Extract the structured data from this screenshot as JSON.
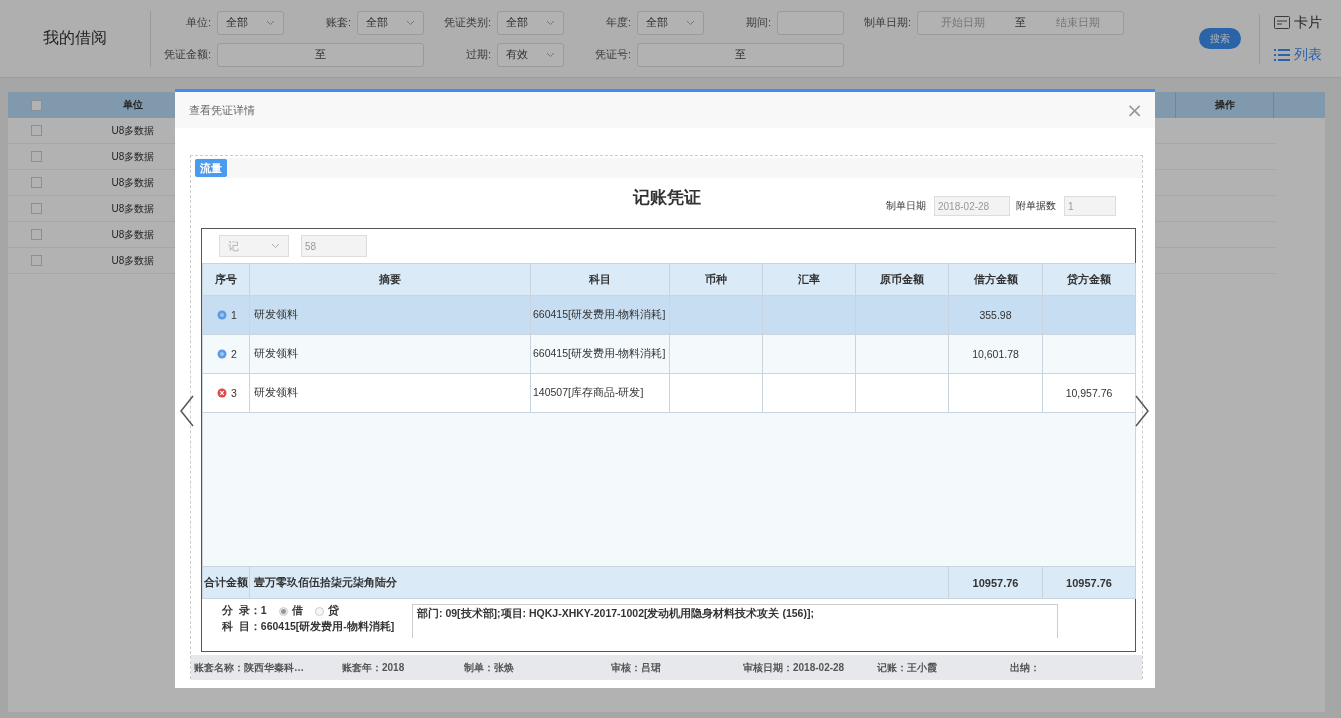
{
  "page": {
    "title": "我的借阅"
  },
  "filters": {
    "rows": [
      [
        {
          "kind": "select",
          "label": "单位:",
          "value": "全部"
        },
        {
          "kind": "select",
          "label": "账套:",
          "value": "全部"
        },
        {
          "kind": "select",
          "label": "凭证类别:",
          "value": "全部"
        },
        {
          "kind": "select",
          "label": "年度:",
          "value": "全部"
        },
        {
          "kind": "input",
          "label": "期间:"
        },
        {
          "kind": "range",
          "label": "制单日期:",
          "from_placeholder": "开始日期",
          "separator": "至",
          "to_placeholder": "结束日期"
        }
      ],
      [
        {
          "kind": "range",
          "label": "凭证金额:",
          "separator": "至"
        },
        "",
        {
          "kind": "select",
          "label": "过期:",
          "value": "有效"
        },
        {
          "kind": "range",
          "label": "凭证号:",
          "separator": "至"
        }
      ]
    ]
  },
  "search_button": "搜索",
  "views": [
    {
      "kind": "card",
      "label": "卡片",
      "selected": false
    },
    {
      "kind": "list",
      "label": "列表",
      "selected": true
    }
  ],
  "list_table": {
    "header_checked": false,
    "columns": [
      "单位",
      "操作"
    ],
    "rows": [
      {
        "checked": false,
        "unit": "U8多数据"
      },
      {
        "checked": false,
        "unit": "U8多数据"
      },
      {
        "checked": false,
        "unit": "U8多数据"
      },
      {
        "checked": false,
        "unit": "U8多数据"
      },
      {
        "checked": false,
        "unit": "U8多数据"
      },
      {
        "checked": false,
        "unit": "U8多数据"
      }
    ]
  },
  "dialog": {
    "title": "查看凭证详情",
    "close": "×",
    "tabs": [
      {
        "label": "流量",
        "selected": true
      }
    ],
    "voucher": {
      "title": "记账凭证",
      "date_label": "制单日期",
      "date": "2018-02-28",
      "attachments_label": "附单据数",
      "attachments": "1",
      "type": "记",
      "number": "58",
      "columns": [
        "序号",
        "摘要",
        "科目",
        "币种",
        "汇率",
        "原币金额",
        "借方金额",
        "贷方金额"
      ],
      "entries": [
        {
          "kind": "info",
          "seq": "1",
          "summary": "研发领料",
          "account": "660415[研发费用-物料消耗]",
          "debit": "355.98",
          "selected": true
        },
        {
          "kind": "info",
          "seq": "2",
          "summary": "研发领料",
          "account": "660415[研发费用-物料消耗]",
          "debit": "10,601.78",
          "selected": false
        },
        {
          "kind": "error",
          "seq": "3",
          "summary": "研发领料",
          "account": "140507[库存商品-研发]",
          "credit": "10,957.76",
          "selected": false
        }
      ],
      "total": {
        "label": "合计金额",
        "words": "壹万零玖佰伍拾柒元柒角陆分",
        "debit": "10957.76",
        "credit": "10957.76"
      },
      "detail": {
        "entry": "分  录：1",
        "sides": [
          {
            "label": "借",
            "selected": true
          },
          {
            "label": "贷",
            "selected": false
          }
        ],
        "account": "科  目：660415[研发费用-物料消耗]",
        "note": "部门: 09[技术部];项目: HQKJ-XHKY-2017-1002[发动机用隐身材料技术攻关 (156)];"
      }
    },
    "info": [
      "账套名称：陕西华秦科…",
      "账套年：2018",
      "制单：张焕",
      "审核：吕珺",
      "审核日期：2018-02-28",
      "记账：王小霞",
      "出纳："
    ]
  }
}
